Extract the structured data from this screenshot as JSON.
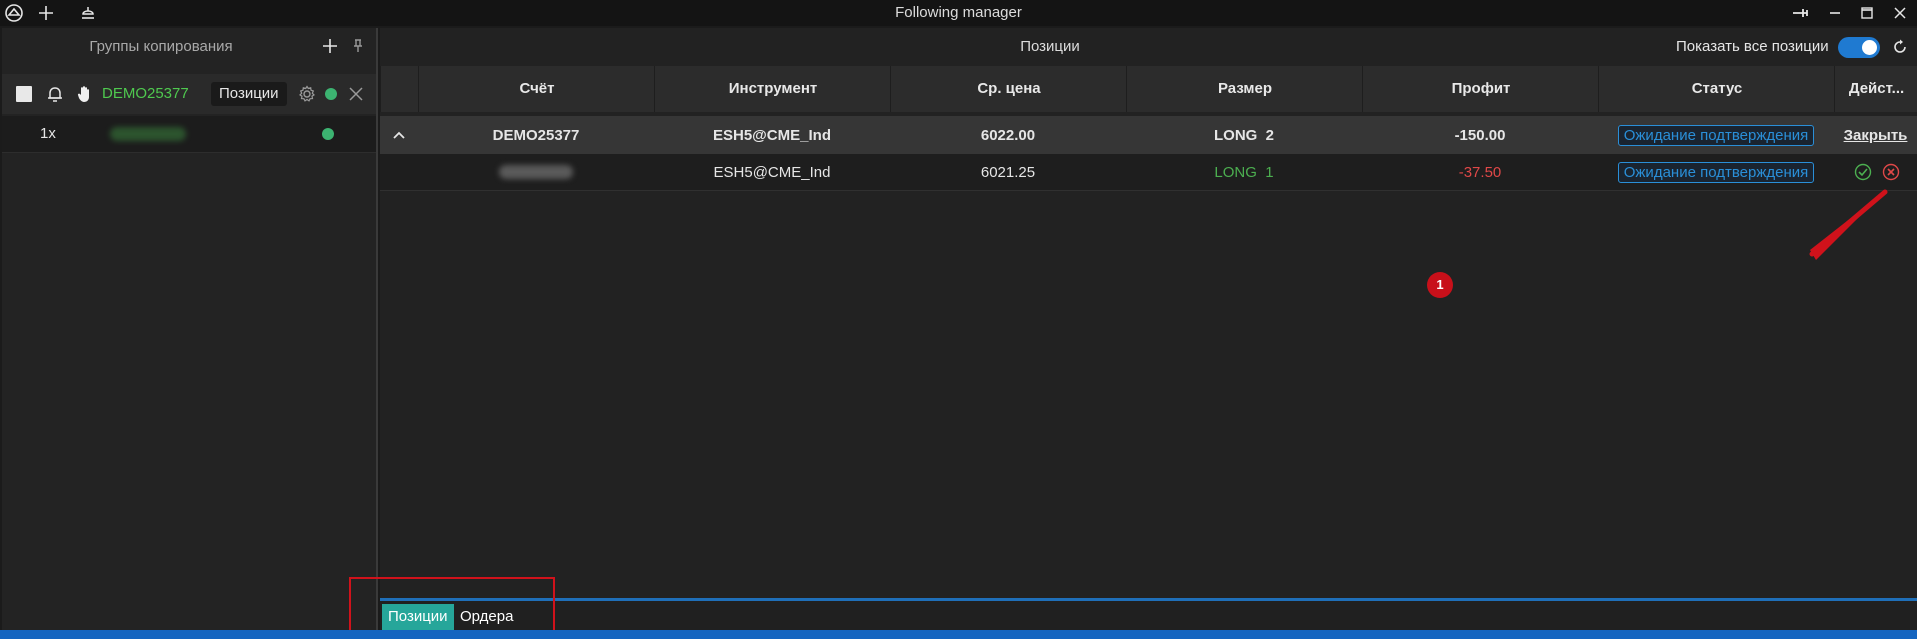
{
  "window": {
    "title": "Following manager"
  },
  "left_panel": {
    "header": "Группы копирования",
    "group": {
      "name": "DEMO25377",
      "tab_label": "Позиции"
    },
    "follower": {
      "multiplier": "1x"
    }
  },
  "right_panel": {
    "title": "Позиции",
    "show_all_label": "Показать все позиции",
    "show_all_on": true,
    "columns": [
      "Счёт",
      "Инструмент",
      "Ср. цена",
      "Размер",
      "Профит",
      "Статус",
      "Дейст..."
    ],
    "parent_row": {
      "account": "DEMO25377",
      "instrument": "ESH5@CME_Ind",
      "avg_price": "6022.00",
      "size": "LONG  2",
      "profit": "-150.00",
      "status": "Ожидание подтверждения",
      "action": "Закрыть"
    },
    "child_row": {
      "instrument": "ESH5@CME_Ind",
      "avg_price": "6021.25",
      "size": "LONG  1",
      "profit": "-37.50",
      "status": "Ожидание подтверждения"
    }
  },
  "annotation": {
    "marker": "1"
  },
  "bottom_tabs": [
    "Позиции",
    "Ордера"
  ],
  "colors": {
    "accent": "#2a8fd8",
    "positive": "#4caf50",
    "negative": "#e04848",
    "online": "#3cb371",
    "annotation_red": "#d0121b"
  }
}
